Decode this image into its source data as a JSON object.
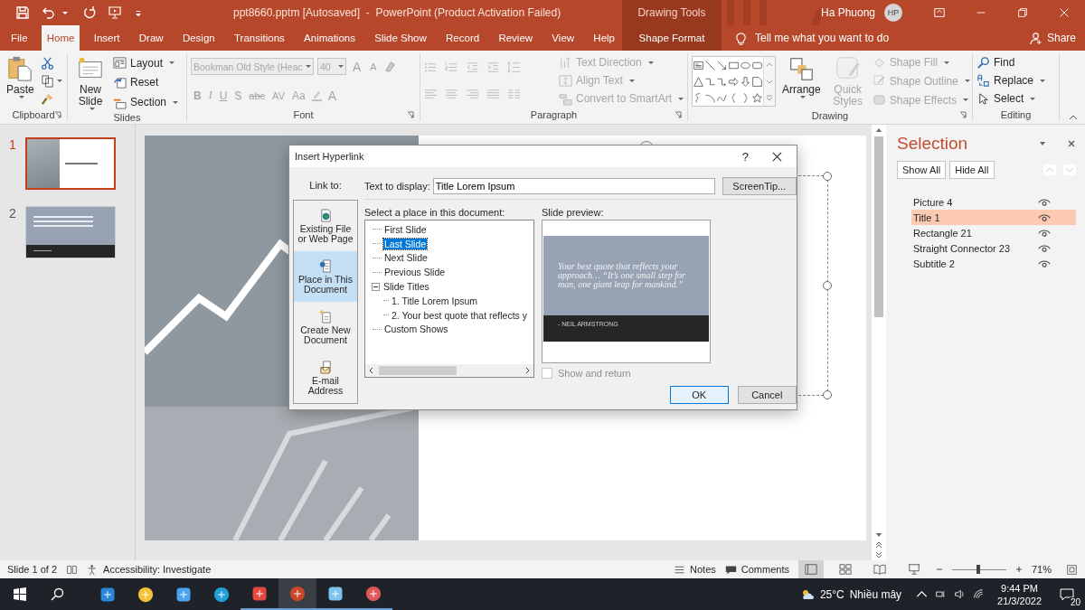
{
  "title_bar": {
    "title": "ppt8660.pptm [Autosaved]  -  PowerPoint (Product Activation Failed)",
    "context_label": "Drawing Tools",
    "user": "Ha Phuong",
    "avatar": "HP"
  },
  "tabs": [
    {
      "label": "File",
      "selected": false,
      "kind": "tab"
    },
    {
      "label": "Home",
      "selected": true,
      "kind": "tab"
    },
    {
      "label": "Insert",
      "selected": false,
      "kind": "tab"
    },
    {
      "label": "Draw",
      "selected": false,
      "kind": "tab"
    },
    {
      "label": "Design",
      "selected": false,
      "kind": "tab"
    },
    {
      "label": "Transitions",
      "selected": false,
      "kind": "tab"
    },
    {
      "label": "Animations",
      "selected": false,
      "kind": "tab"
    },
    {
      "label": "Slide Show",
      "selected": false,
      "kind": "tab"
    },
    {
      "label": "Record",
      "selected": false,
      "kind": "tab"
    },
    {
      "label": "Review",
      "selected": false,
      "kind": "tab"
    },
    {
      "label": "View",
      "selected": false,
      "kind": "tab"
    },
    {
      "label": "Help",
      "selected": false,
      "kind": "tab"
    },
    {
      "label": "Shape Format",
      "selected": false,
      "kind": "contextual"
    }
  ],
  "tell_me": "Tell me what you want to do",
  "share": "Share",
  "ribbon": {
    "clipboard": {
      "label": "Clipboard",
      "paste": "Paste"
    },
    "slides": {
      "label": "Slides",
      "new_slide": "New Slide",
      "commands": [
        {
          "label": "Layout",
          "disabled": false
        },
        {
          "label": "Reset",
          "disabled": false
        },
        {
          "label": "Section",
          "disabled": false
        }
      ]
    },
    "font": {
      "label": "Font",
      "disabled": true,
      "font_name": "Bookman Old Style (Heac",
      "font_size": "40",
      "size_buttons": [
        "A",
        "A"
      ],
      "style_buttons": [
        "B",
        "I",
        "U",
        "S",
        "abc",
        "AV",
        "Aa"
      ],
      "color_button": "A"
    },
    "paragraph": {
      "label": "Paragraph",
      "commands": [
        {
          "label": "Text Direction",
          "disabled": true
        },
        {
          "label": "Align Text",
          "disabled": true
        },
        {
          "label": "Convert to SmartArt",
          "disabled": true
        }
      ]
    },
    "drawing": {
      "label": "Drawing",
      "arrange": "Arrange",
      "quick_styles": {
        "label": "Quick Styles",
        "disabled": true
      },
      "commands": [
        {
          "label": "Shape Fill",
          "disabled": true
        },
        {
          "label": "Shape Outline",
          "disabled": true
        },
        {
          "label": "Shape Effects",
          "disabled": true
        }
      ]
    },
    "editing": {
      "label": "Editing",
      "commands": [
        {
          "label": "Find",
          "disabled": false
        },
        {
          "label": "Replace",
          "disabled": false
        },
        {
          "label": "Select",
          "disabled": false
        }
      ]
    }
  },
  "thumbnails": [
    {
      "number": "1",
      "selected": true,
      "kind": "title"
    },
    {
      "number": "2",
      "selected": false,
      "kind": "quote"
    }
  ],
  "dialog": {
    "title": "Insert Hyperlink",
    "help": "?",
    "link_to": "Link to:",
    "link_options": [
      {
        "label": "Existing File or Web Page",
        "selected": false
      },
      {
        "label": "Place in This Document",
        "selected": true
      },
      {
        "label": "Create New Document",
        "selected": false
      },
      {
        "label": "E-mail Address",
        "selected": false
      }
    ],
    "text_label": "Text to display:",
    "text_value": "Title Lorem Ipsum",
    "screentip": "ScreenTip...",
    "place_label": "Select a place in this document:",
    "places": [
      {
        "label": "First Slide",
        "selected": false
      },
      {
        "label": "Last Slide",
        "selected": true
      },
      {
        "label": "Next Slide",
        "selected": false
      },
      {
        "label": "Previous Slide",
        "selected": false
      },
      {
        "label": "Slide Titles",
        "selected": false,
        "expanded": true,
        "children": [
          {
            "label": "1. Title Lorem Ipsum",
            "selected": false
          },
          {
            "label": "2. Your best quote that reflects y",
            "selected": false
          }
        ]
      },
      {
        "label": "Custom Shows",
        "selected": false
      }
    ],
    "preview_label": "Slide preview:",
    "preview": {
      "quote": "Your best quote that reflects your approach… “It’s one small step for man, one giant leap for mankind.”",
      "author": "- NEIL ARMSTRONG"
    },
    "show_return": {
      "label": "Show and return",
      "checked": false,
      "disabled": true
    },
    "buttons": [
      {
        "label": "OK",
        "kind": "default"
      },
      {
        "label": "Cancel",
        "kind": "normal"
      }
    ]
  },
  "selection_pane": {
    "title": "Selection",
    "show_all": "Show All",
    "hide_all": "Hide All",
    "items": [
      {
        "label": "Picture 4",
        "selected": false,
        "visible": true
      },
      {
        "label": "Title 1",
        "selected": true,
        "visible": true
      },
      {
        "label": "Rectangle 21",
        "selected": false,
        "visible": true
      },
      {
        "label": "Straight Connector 23",
        "selected": false,
        "visible": true
      },
      {
        "label": "Subtitle 2",
        "selected": false,
        "visible": true
      }
    ]
  },
  "status_bar": {
    "slide": "Slide 1 of 2",
    "accessibility": "Accessibility: Investigate",
    "notes": "Notes",
    "comments": "Comments",
    "views": [
      {
        "selected": true
      },
      {
        "selected": false
      },
      {
        "selected": false
      },
      {
        "selected": false
      }
    ],
    "zoom_slider": {
      "level": 0.49
    },
    "zoom": "71%"
  },
  "taskbar": {
    "apps": [
      {
        "running": false,
        "selected": false
      },
      {
        "running": false,
        "selected": false
      },
      {
        "running": false,
        "selected": false
      },
      {
        "running": false,
        "selected": false
      },
      {
        "running": true,
        "selected": false
      },
      {
        "running": true,
        "selected": true
      },
      {
        "running": true,
        "selected": false
      },
      {
        "running": true,
        "selected": false
      }
    ],
    "temperature": "25°C",
    "weather": "Nhiều mây",
    "time": "9:44 PM",
    "date": "21/3/2022",
    "notifications": "20"
  }
}
